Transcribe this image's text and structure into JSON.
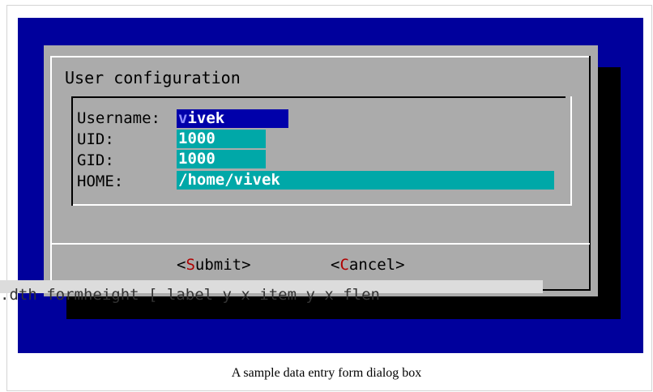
{
  "dialog": {
    "title": "User configuration",
    "fields": [
      {
        "label": "Username:",
        "value_first": "v",
        "value_rest": "ivek"
      },
      {
        "label": "UID:",
        "value": "1000"
      },
      {
        "label": "GID:",
        "value": "1000"
      },
      {
        "label": "HOME:",
        "value": "/home/vivek"
      }
    ],
    "buttons": {
      "submit": {
        "open": "<",
        "hotkey": "S",
        "rest": "ubmit",
        "close": ">"
      },
      "cancel": {
        "open": "<",
        "hotkey": "C",
        "rest": "ancel",
        "close": ">"
      }
    }
  },
  "overlay_text": ".dth formheight [ label y x item y x flen",
  "caption": "A sample data entry form dialog box",
  "colors": {
    "screen_bg": "#00009c",
    "dialog_bg": "#ababab",
    "field_bg": "#00a8a8",
    "field_focus_bg": "#0000aa",
    "hotkey": "#b00000"
  }
}
